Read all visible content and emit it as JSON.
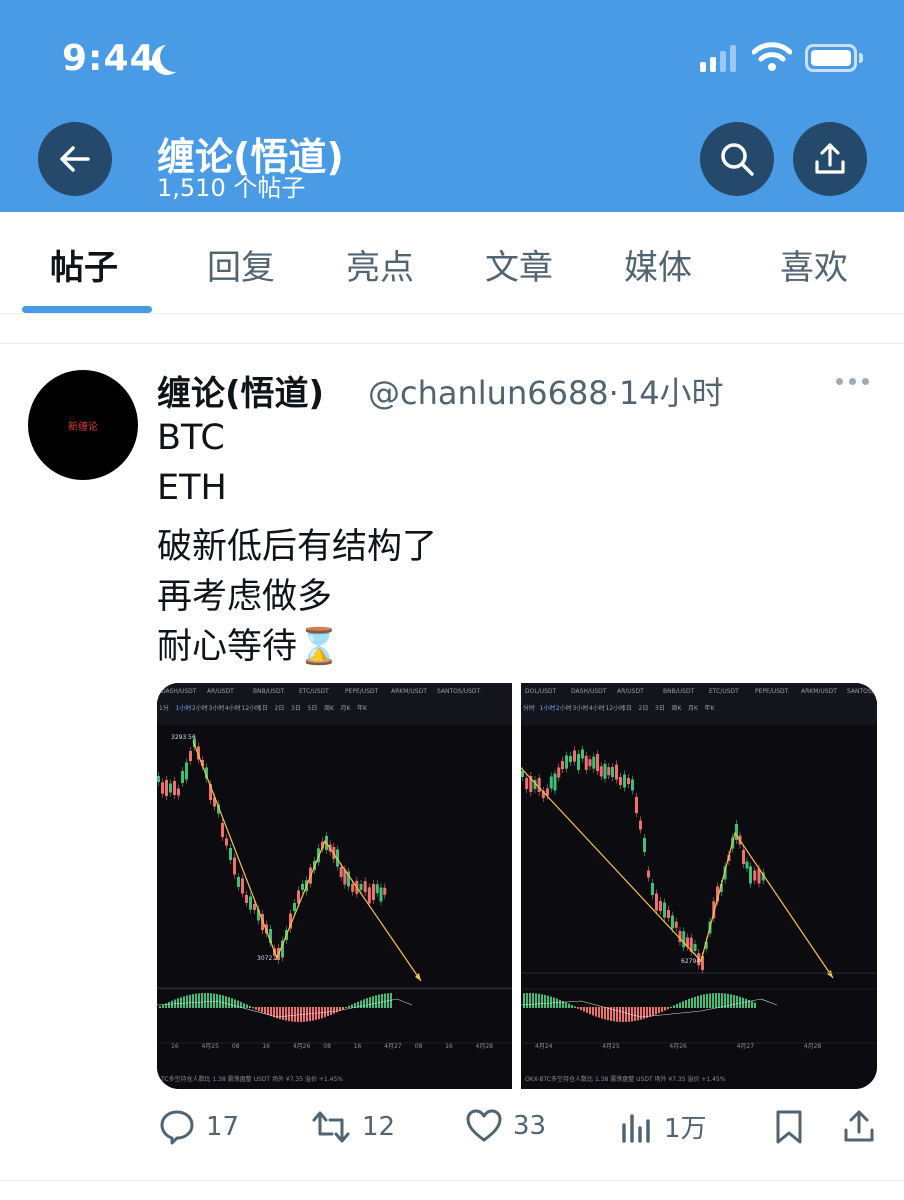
{
  "status_bar": {
    "time": "9:44"
  },
  "header": {
    "title": "缠论(悟道)",
    "post_count": "1,510 个帖子"
  },
  "tabs": [
    {
      "label": "帖子",
      "active": true
    },
    {
      "label": "回复"
    },
    {
      "label": "亮点"
    },
    {
      "label": "文章"
    },
    {
      "label": "媒体"
    },
    {
      "label": "喜欢"
    }
  ],
  "tweet": {
    "avatar_text": "新缠论",
    "author": "缠论(悟道)",
    "handle": "@chanlun6688",
    "time": "·14小时",
    "lines": [
      "BTC",
      "ETH",
      "破新低后有结构了",
      "再考虑做多",
      "耐心等待⌛"
    ],
    "actions": {
      "replies": "17",
      "retweets": "12",
      "likes": "33",
      "views": "1万"
    }
  },
  "charts": [
    {
      "tickers": [
        "DASH/USDT",
        "AR/USDT",
        "BNB/USDT",
        "ETC/USDT",
        "PEPE/USDT",
        "ARKM/USDT",
        "SANTOS/USDT"
      ],
      "timeframes": [
        "1分",
        "1小时",
        "2小时",
        "3小时",
        "4小时",
        "12小时",
        "1日",
        "2日",
        "3日",
        "5日",
        "周K",
        "月K",
        "年K"
      ],
      "high_label": "3293.56",
      "low_label": "3072.2",
      "x_labels": [
        "16",
        "4月25",
        "08",
        "16",
        "4月26",
        "08",
        "16",
        "4月27",
        "08",
        "16",
        "4月28"
      ],
      "footer": "TC多空持仓人数比  1.38  震荡盘整     USDT 场外  ¥7.35  溢价 +1.45%"
    },
    {
      "tickers": [
        "DOL/USDT",
        "DASH/USDT",
        "AR/USDT",
        "BNB/USDT",
        "ETC/USDT",
        "PEPE/USDT",
        "ARKM/USDT",
        "SANTOS/USDT"
      ],
      "timeframes": [
        "分时",
        "1小时",
        "2小时",
        "3小时",
        "4小时",
        "12小时",
        "1日",
        "2日",
        "3日",
        "周K",
        "月K",
        "年K"
      ],
      "low_label": "62794",
      "x_labels": [
        "4月24",
        "4月25",
        "4月26",
        "4月27",
        "4月28"
      ],
      "footer": "OKX-BTC多空持仓人数比  1.38  震荡盘整     USDT 场外  ¥7.35  溢价 +1.45%"
    }
  ],
  "colors": {
    "header_bg": "#4a9be6",
    "circle_btn": "#24496a",
    "candle_up": "#3cc07a",
    "candle_down": "#f07070",
    "trend_line": "#f5c542"
  },
  "icons": [
    "back-arrow-icon",
    "search-icon",
    "share-icon",
    "reply-icon",
    "retweet-icon",
    "like-icon",
    "views-icon",
    "bookmark-icon",
    "share-action-icon",
    "more-dots-icon"
  ]
}
